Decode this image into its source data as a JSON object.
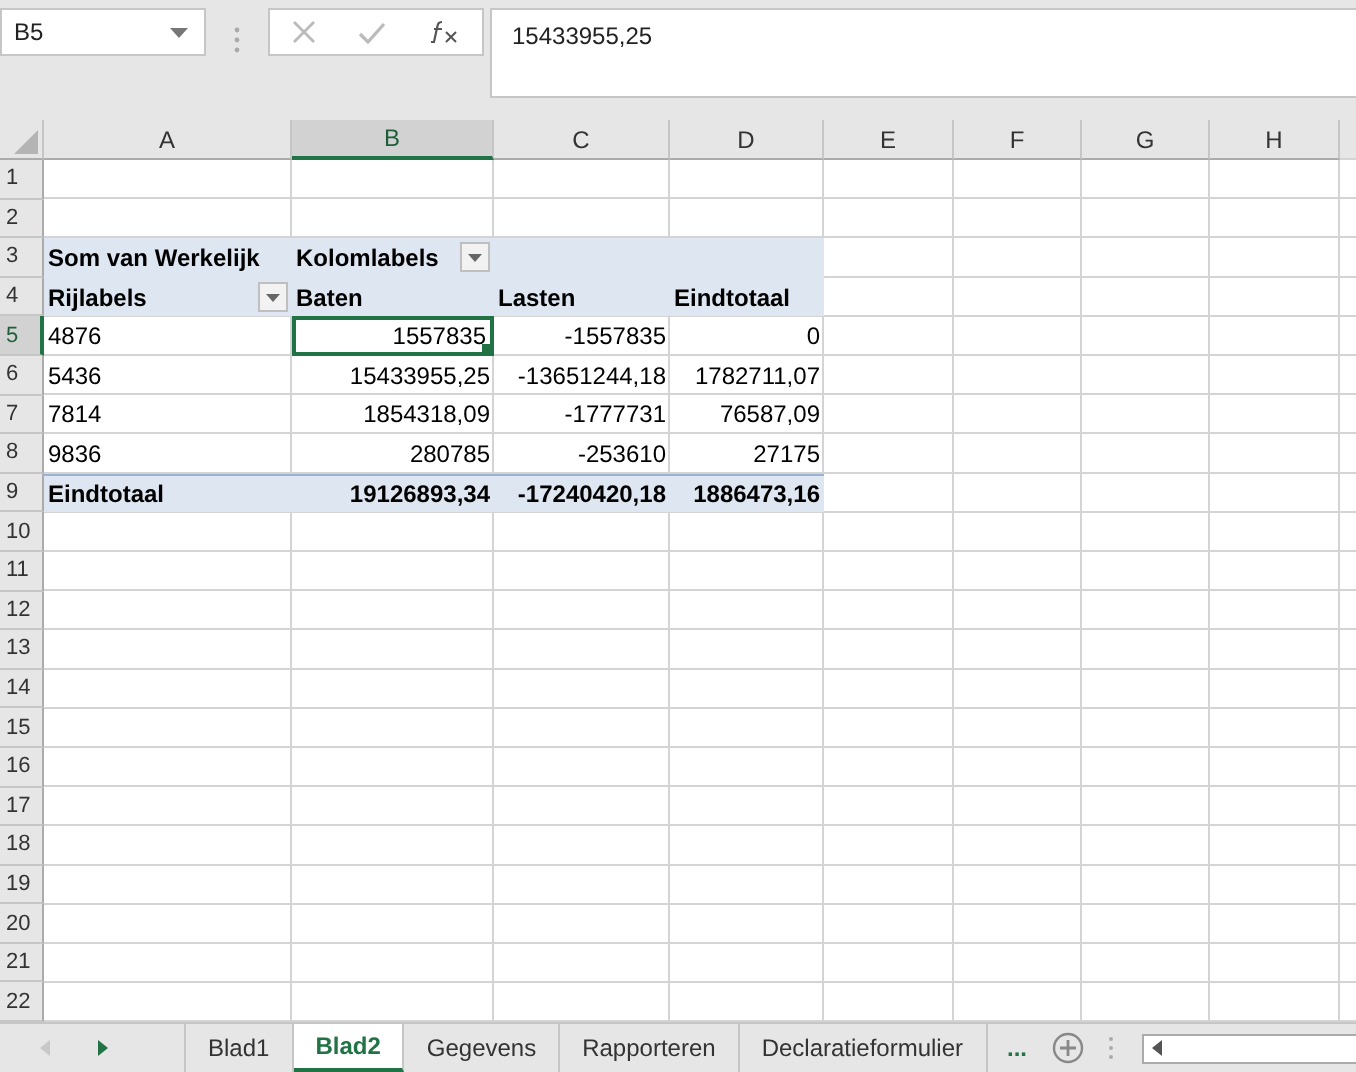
{
  "formula_bar": {
    "name_box": "B5",
    "formula": "15433955,25"
  },
  "columns": [
    {
      "label": "A",
      "selected": false
    },
    {
      "label": "B",
      "selected": true
    },
    {
      "label": "C",
      "selected": false
    },
    {
      "label": "D",
      "selected": false
    },
    {
      "label": "E",
      "selected": false
    },
    {
      "label": "F",
      "selected": false
    },
    {
      "label": "G",
      "selected": false
    },
    {
      "label": "H",
      "selected": false
    }
  ],
  "rows": [
    {
      "label": "1",
      "selected": false,
      "kind": "empty"
    },
    {
      "label": "2",
      "selected": false,
      "kind": "empty"
    },
    {
      "label": "3",
      "selected": false,
      "kind": "pivot-header",
      "cells": [
        {
          "text": "Som van Werkelijk",
          "filter": false,
          "selected": false
        },
        {
          "text": "Kolomlabels",
          "filter": true,
          "selected": false
        }
      ]
    },
    {
      "label": "4",
      "selected": false,
      "kind": "pivot-header",
      "cells": [
        {
          "text": "Rijlabels",
          "filter": true,
          "selected": false
        },
        {
          "text": "Baten",
          "filter": false,
          "selected": false
        },
        {
          "text": "Lasten",
          "filter": false,
          "selected": false
        },
        {
          "text": "Eindtotaal",
          "filter": false,
          "selected": false
        }
      ]
    },
    {
      "label": "5",
      "selected": true,
      "kind": "pivot-data",
      "cells": [
        {
          "text": "4876",
          "filter": false,
          "selected": false
        },
        {
          "text": "1557835",
          "filter": false,
          "selected": true
        },
        {
          "text": "-1557835",
          "filter": false,
          "selected": false
        },
        {
          "text": "0",
          "filter": false,
          "selected": false
        }
      ]
    },
    {
      "label": "6",
      "selected": false,
      "kind": "pivot-data",
      "cells": [
        {
          "text": "5436",
          "filter": false,
          "selected": false
        },
        {
          "text": "15433955,25",
          "filter": false,
          "selected": false
        },
        {
          "text": "-13651244,18",
          "filter": false,
          "selected": false
        },
        {
          "text": "1782711,07",
          "filter": false,
          "selected": false
        }
      ]
    },
    {
      "label": "7",
      "selected": false,
      "kind": "pivot-data",
      "cells": [
        {
          "text": "7814",
          "filter": false,
          "selected": false
        },
        {
          "text": "1854318,09",
          "filter": false,
          "selected": false
        },
        {
          "text": "-1777731",
          "filter": false,
          "selected": false
        },
        {
          "text": "76587,09",
          "filter": false,
          "selected": false
        }
      ]
    },
    {
      "label": "8",
      "selected": false,
      "kind": "pivot-data",
      "cells": [
        {
          "text": "9836",
          "filter": false,
          "selected": false
        },
        {
          "text": "280785",
          "filter": false,
          "selected": false
        },
        {
          "text": "-253610",
          "filter": false,
          "selected": false
        },
        {
          "text": "27175",
          "filter": false,
          "selected": false
        }
      ]
    },
    {
      "label": "9",
      "selected": false,
      "kind": "pivot-total",
      "cells": [
        {
          "text": "Eindtotaal",
          "filter": false,
          "selected": false
        },
        {
          "text": "19126893,34",
          "filter": false,
          "selected": false
        },
        {
          "text": "-17240420,18",
          "filter": false,
          "selected": false
        },
        {
          "text": "1886473,16",
          "filter": false,
          "selected": false
        }
      ]
    },
    {
      "label": "10",
      "selected": false,
      "kind": "empty"
    },
    {
      "label": "11",
      "selected": false,
      "kind": "empty"
    },
    {
      "label": "12",
      "selected": false,
      "kind": "empty"
    },
    {
      "label": "13",
      "selected": false,
      "kind": "empty"
    },
    {
      "label": "14",
      "selected": false,
      "kind": "empty"
    },
    {
      "label": "15",
      "selected": false,
      "kind": "empty"
    },
    {
      "label": "16",
      "selected": false,
      "kind": "empty"
    },
    {
      "label": "17",
      "selected": false,
      "kind": "empty"
    },
    {
      "label": "18",
      "selected": false,
      "kind": "empty"
    },
    {
      "label": "19",
      "selected": false,
      "kind": "empty"
    },
    {
      "label": "20",
      "selected": false,
      "kind": "empty"
    },
    {
      "label": "21",
      "selected": false,
      "kind": "empty"
    },
    {
      "label": "22",
      "selected": false,
      "kind": "empty"
    }
  ],
  "sheet_tabs": [
    {
      "label": "Blad1",
      "selected": false
    },
    {
      "label": "Blad2",
      "selected": true
    },
    {
      "label": "Gegevens",
      "selected": false
    },
    {
      "label": "Rapporteren",
      "selected": false
    },
    {
      "label": "Declaratieformulier",
      "selected": false
    }
  ],
  "more_tabs": "..."
}
